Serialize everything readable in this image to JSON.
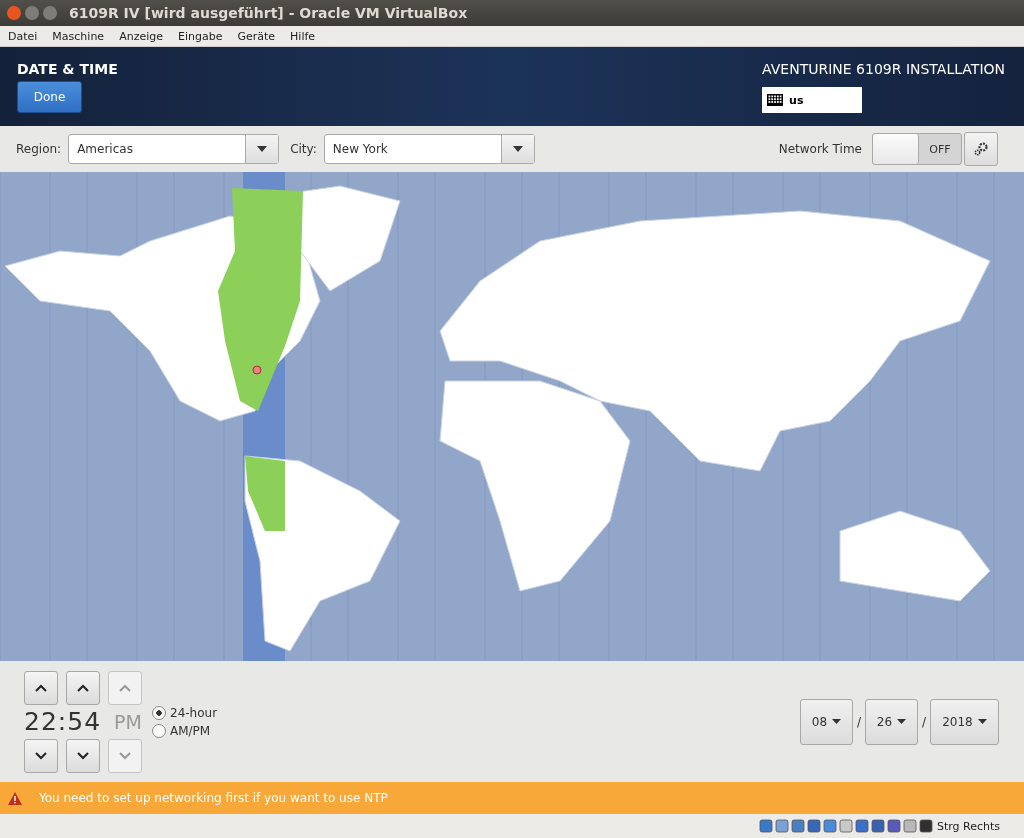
{
  "window": {
    "title": "6109R IV [wird ausgeführt] - Oracle VM VirtualBox"
  },
  "menu": [
    "Datei",
    "Maschine",
    "Anzeige",
    "Eingabe",
    "Geräte",
    "Hilfe"
  ],
  "header": {
    "title": "DATE & TIME",
    "done_button": "Done",
    "product": "AVENTURINE 6109R INSTALLATION",
    "keyboard_layout": "us"
  },
  "region": {
    "label": "Region:",
    "value": "Americas"
  },
  "city": {
    "label": "City:",
    "value": "New York"
  },
  "network_time": {
    "label": "Network Time",
    "on": false,
    "state_text": "OFF"
  },
  "time": {
    "value": "22:54",
    "ampm": "PM",
    "ampm_disabled": true,
    "formats": [
      {
        "label": "24-hour",
        "selected": true
      },
      {
        "label": "AM/PM",
        "selected": false
      }
    ]
  },
  "date": {
    "fields": [
      "08",
      "26",
      "2018"
    ],
    "separators": [
      "/",
      "/"
    ]
  },
  "warning": "You need to set up networking first if you want to use NTP",
  "status_bar": {
    "host_key": "Strg Rechts"
  }
}
